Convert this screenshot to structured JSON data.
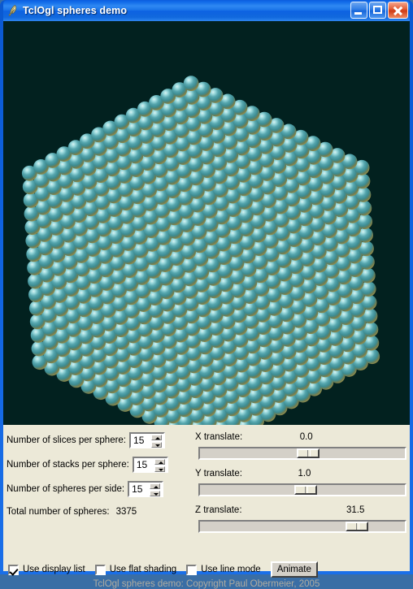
{
  "window": {
    "title": "TclOgl spheres demo",
    "icon": "tcl-feather-icon",
    "buttons": {
      "minimize": "minimize-button",
      "maximize": "maximize-button",
      "close": "close-button"
    }
  },
  "canvas": {
    "background_color": "#02211f",
    "sphere_color": "#3f8f96",
    "sphere_highlight": "#bfe8ea",
    "sphere_rim": "#8f8f52",
    "description": "OpenGL rendered cube of teal shaded spheres"
  },
  "controls": {
    "slices": {
      "label": "Number of slices per sphere:",
      "value": "15"
    },
    "stacks": {
      "label": "Number of stacks per sphere:",
      "value": "15"
    },
    "spheres": {
      "label": "Number of spheres per side:",
      "value": "15"
    },
    "total": {
      "label": "Total number of spheres:",
      "value": "3375"
    },
    "checkboxes": [
      {
        "label": "Use display list",
        "checked": true
      },
      {
        "label": "Use flat shading",
        "checked": false
      },
      {
        "label": "Use line mode",
        "checked": false
      }
    ],
    "animate_button": "Animate",
    "sliders": [
      {
        "label": "X translate:",
        "value": "0.0",
        "position_pct": 53
      },
      {
        "label": "Y translate:",
        "value": "1.0",
        "position_pct": 52
      },
      {
        "label": "Z translate:",
        "value": "31.5",
        "position_pct": 80
      }
    ]
  },
  "status": {
    "text": "TclOgl spheres demo: Copyright Paul Obermeier, 2005",
    "color": "#b0aca0"
  }
}
